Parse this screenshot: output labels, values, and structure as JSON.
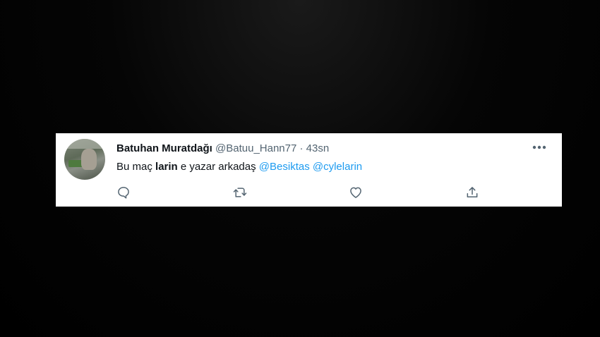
{
  "tweet": {
    "display_name": "Batuhan Muratdağı",
    "handle": "@Batuu_Hann77",
    "separator": "·",
    "timestamp": "43sn",
    "text": {
      "part1": "Bu maç ",
      "bold": "larin",
      "part2": " e yazar arkadaş ",
      "mention1": "@Besiktas",
      "space": " ",
      "mention2": "@cylelarin"
    }
  },
  "actions": {
    "icons": [
      "reply-icon",
      "retweet-icon",
      "like-icon",
      "share-icon"
    ]
  },
  "colors": {
    "card_background": "#ffffff",
    "page_background": "#000000",
    "text_primary": "#0f1419",
    "text_secondary": "#536471",
    "mention": "#1d9bf0"
  }
}
